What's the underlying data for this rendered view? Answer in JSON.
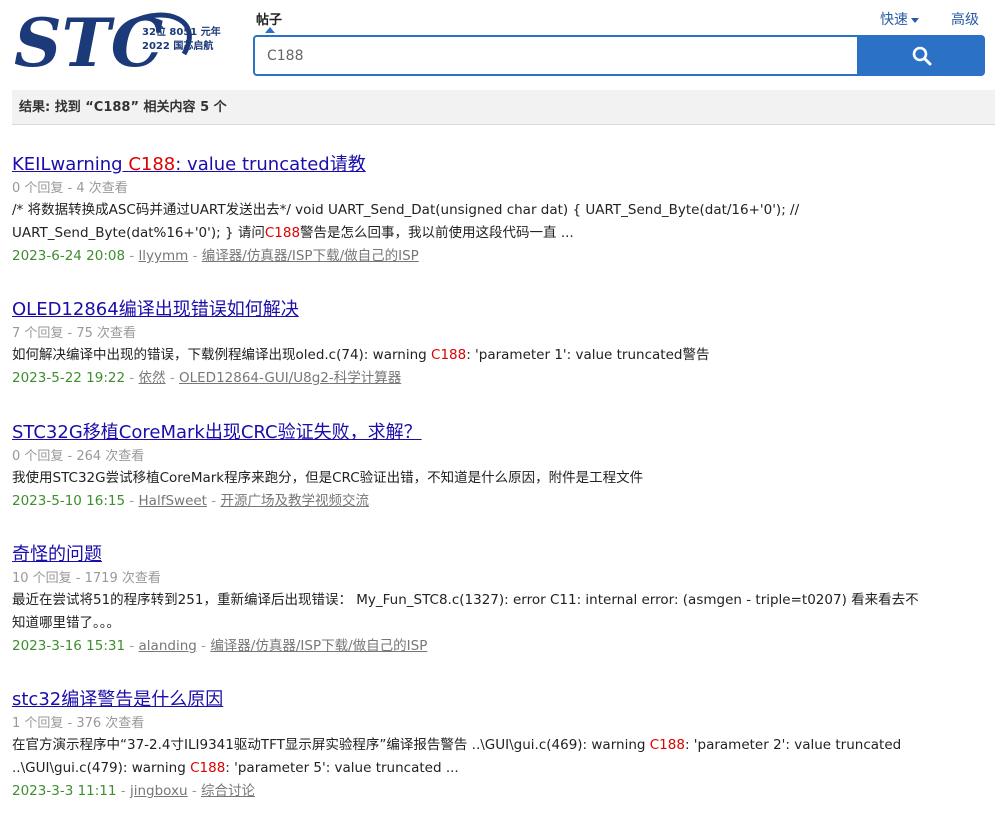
{
  "logo": {
    "text": "STC",
    "tagline1": "32位 8051 元年",
    "tagline2": "2022 国芯启航"
  },
  "search": {
    "tab_label": "帖子",
    "value": "C188",
    "quick_label": "快速",
    "advanced_label": "高级",
    "button_icon": "search-icon"
  },
  "result_summary": "结果: 找到 “C188” 相关内容 5 个",
  "results": [
    {
      "title_pre": "KEILwarning ",
      "title_hl": "C188",
      "title_post": ": value truncated请教",
      "stats": "0 个回复 - 4 次查看",
      "snippet_line1_pre": "/* 将数据转换成ASC码并通过UART发送出去*/ void UART_Send_Dat(unsigned char dat) { UART_Send_Byte(dat/16+'0'); //",
      "snippet_line2_pre": "UART_Send_Byte(dat%16+'0'); } 请问",
      "snippet_line2_hl": "C188",
      "snippet_line2_post": "警告是怎么回事，我以前使用这段代码一直 ...",
      "date": "2023-6-24 20:08",
      "author": "llyymm",
      "forum": "编译器/仿真器/ISP下载/做自己的ISP"
    },
    {
      "title": "OLED12864编译出现错误如何解决",
      "stats": "7 个回复 - 75 次查看",
      "snippet_pre": "如何解决编译中出现的错误，下载例程编译出现oled.c(74): warning ",
      "snippet_hl": "C188",
      "snippet_post": ": 'parameter 1': value truncated警告",
      "date": "2023-5-22 19:22",
      "author": "依然",
      "forum": "OLED12864-GUI/U8g2-科学计算器"
    },
    {
      "title": "STC32G移植CoreMark出现CRC验证失败，求解？",
      "stats": "0 个回复 - 264 次查看",
      "snippet": "我使用STC32G尝试移植CoreMark程序来跑分，但是CRC验证出错，不知道是什么原因，附件是工程文件",
      "date": "2023-5-10 16:15",
      "author": "HalfSweet",
      "forum": "开源广场及教学视频交流"
    },
    {
      "title": "奇怪的问题",
      "stats": "10 个回复 - 1719 次查看",
      "snippet_line1": "最近在尝试将51的程序转到251，重新编译后出现错误： My_Fun_STC8.c(1327): error C11: internal error: (asmgen - triple=t0207) 看来看去不",
      "snippet_line2": "知道哪里错了。。。",
      "date": "2023-3-16 15:31",
      "author": "alanding",
      "forum": "编译器/仿真器/ISP下载/做自己的ISP"
    },
    {
      "title": "stc32编译警告是什么原因",
      "stats": "1 个回复 - 376 次查看",
      "snippet_line1_pre": "在官方演示程序中“37-2.4寸ILI9341驱动TFT显示屏实验程序”编译报告警告 ..\\GUI\\gui.c(469): warning ",
      "snippet_line1_hl": "C188",
      "snippet_line1_post": ": 'parameter 2': value truncated",
      "snippet_line2_pre": "..\\GUI\\gui.c(479): warning ",
      "snippet_line2_hl": "C188",
      "snippet_line2_post": ": 'parameter 5': value truncated ...",
      "date": "2023-3-3 11:11",
      "author": "jingboxu",
      "forum": "综合讨论"
    }
  ],
  "colors": {
    "accent": "#2b72c7",
    "title_link": "#1a0dab",
    "highlight": "#e00000",
    "date": "#3e8e2f"
  }
}
